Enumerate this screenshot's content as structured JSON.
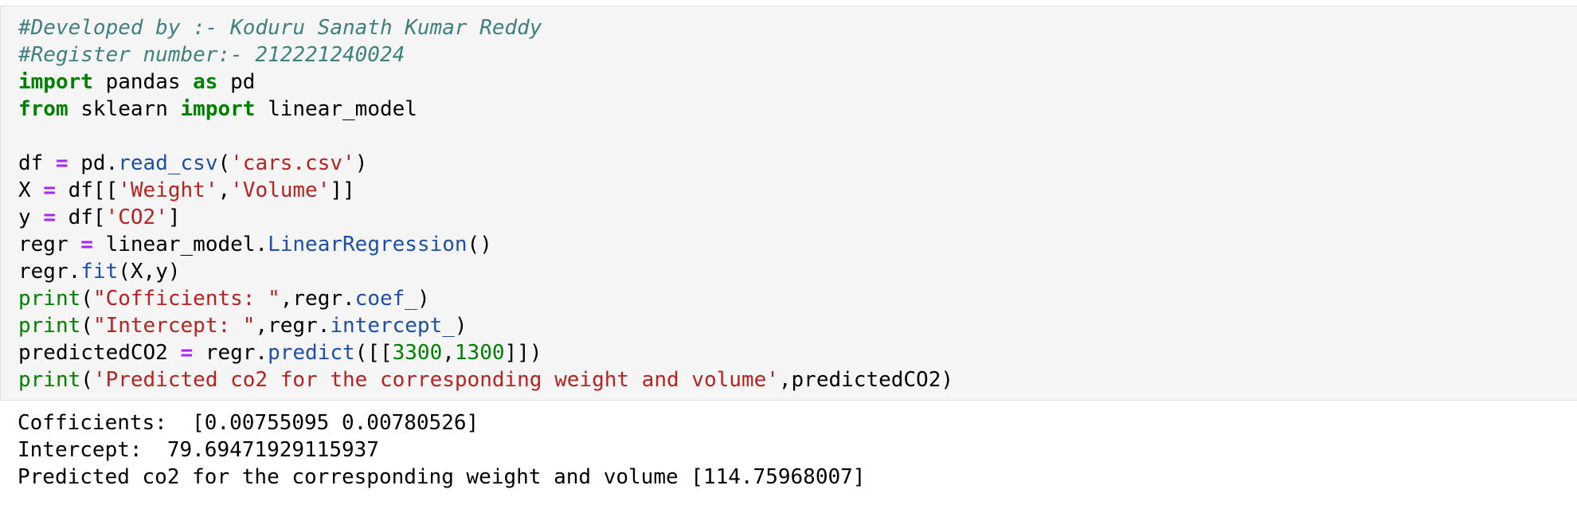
{
  "theme": {
    "cell_background": "#f5f5f5",
    "cell_border": "#e0e0e0",
    "comment_color": "#408080",
    "keyword_color": "#008000",
    "operator_color": "#aa22ff",
    "string_color": "#ba2121",
    "attribute_color": "#1d4fa8"
  },
  "code_cell": {
    "lines": [
      [
        {
          "t": "comment",
          "v": "#Developed by :- Koduru Sanath Kumar Reddy"
        }
      ],
      [
        {
          "t": "comment",
          "v": "#Register number:- 212221240024"
        }
      ],
      [
        {
          "t": "keyword",
          "v": "import"
        },
        {
          "t": "plain",
          "v": " pandas "
        },
        {
          "t": "keyword",
          "v": "as"
        },
        {
          "t": "plain",
          "v": " pd"
        }
      ],
      [
        {
          "t": "keyword",
          "v": "from"
        },
        {
          "t": "plain",
          "v": " sklearn "
        },
        {
          "t": "keyword",
          "v": "import"
        },
        {
          "t": "plain",
          "v": " linear_model"
        }
      ],
      [],
      [
        {
          "t": "plain",
          "v": "df "
        },
        {
          "t": "operator",
          "v": "="
        },
        {
          "t": "plain",
          "v": " pd."
        },
        {
          "t": "attr",
          "v": "read_csv"
        },
        {
          "t": "plain",
          "v": "("
        },
        {
          "t": "string",
          "v": "'cars.csv'"
        },
        {
          "t": "plain",
          "v": ")"
        }
      ],
      [
        {
          "t": "plain",
          "v": "X "
        },
        {
          "t": "operator",
          "v": "="
        },
        {
          "t": "plain",
          "v": " df[["
        },
        {
          "t": "string",
          "v": "'Weight'"
        },
        {
          "t": "plain",
          "v": ","
        },
        {
          "t": "string",
          "v": "'Volume'"
        },
        {
          "t": "plain",
          "v": "]]"
        }
      ],
      [
        {
          "t": "plain",
          "v": "y "
        },
        {
          "t": "operator",
          "v": "="
        },
        {
          "t": "plain",
          "v": " df["
        },
        {
          "t": "string",
          "v": "'CO2'"
        },
        {
          "t": "plain",
          "v": "]"
        }
      ],
      [
        {
          "t": "plain",
          "v": "regr "
        },
        {
          "t": "operator",
          "v": "="
        },
        {
          "t": "plain",
          "v": " linear_model."
        },
        {
          "t": "attr",
          "v": "LinearRegression"
        },
        {
          "t": "plain",
          "v": "()"
        }
      ],
      [
        {
          "t": "plain",
          "v": "regr."
        },
        {
          "t": "attr",
          "v": "fit"
        },
        {
          "t": "plain",
          "v": "(X,y)"
        }
      ],
      [
        {
          "t": "builtin",
          "v": "print"
        },
        {
          "t": "plain",
          "v": "("
        },
        {
          "t": "string",
          "v": "\"Cofficients: \""
        },
        {
          "t": "plain",
          "v": ",regr."
        },
        {
          "t": "attr",
          "v": "coef_"
        },
        {
          "t": "plain",
          "v": ")"
        }
      ],
      [
        {
          "t": "builtin",
          "v": "print"
        },
        {
          "t": "plain",
          "v": "("
        },
        {
          "t": "string",
          "v": "\"Intercept: \""
        },
        {
          "t": "plain",
          "v": ",regr."
        },
        {
          "t": "attr",
          "v": "intercept_"
        },
        {
          "t": "plain",
          "v": ")"
        }
      ],
      [
        {
          "t": "plain",
          "v": "predictedCO2 "
        },
        {
          "t": "operator",
          "v": "="
        },
        {
          "t": "plain",
          "v": " regr."
        },
        {
          "t": "attr",
          "v": "predict"
        },
        {
          "t": "plain",
          "v": "([["
        },
        {
          "t": "number",
          "v": "3300"
        },
        {
          "t": "plain",
          "v": ","
        },
        {
          "t": "number",
          "v": "1300"
        },
        {
          "t": "plain",
          "v": "]])"
        }
      ],
      [
        {
          "t": "builtin",
          "v": "print"
        },
        {
          "t": "plain",
          "v": "("
        },
        {
          "t": "string",
          "v": "'Predicted co2 for the corresponding weight and volume'"
        },
        {
          "t": "plain",
          "v": ",predictedCO2)"
        }
      ]
    ]
  },
  "output_cell": {
    "lines": [
      "Cofficients:  [0.00755095 0.00780526]",
      "Intercept:  79.69471929115937",
      "Predicted co2 for the corresponding weight and volume [114.75968007]"
    ]
  }
}
